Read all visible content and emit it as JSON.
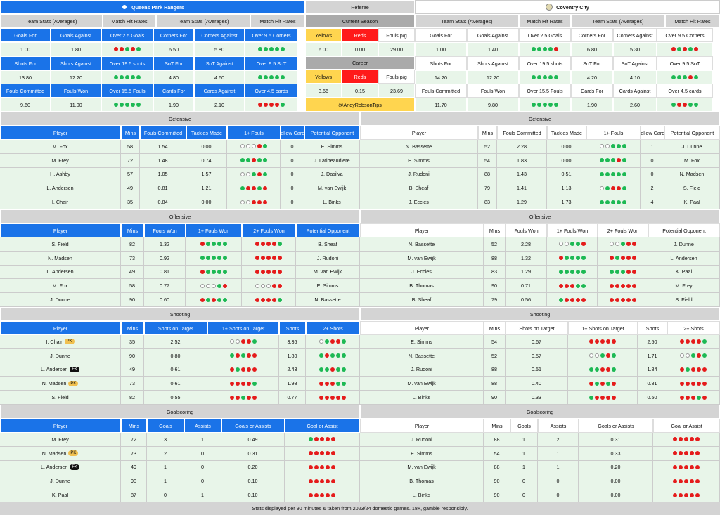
{
  "home": {
    "name": "Queens Park Rangers",
    "color": "#1a73e8"
  },
  "away": {
    "name": "Coventry City"
  },
  "ts": {
    "teamStats": "Team Stats (Averages)",
    "matchHit": "Match Hit Rates",
    "referee": "Referee",
    "currentSeason": "Current Season",
    "career": "Career",
    "handle": "@AndyRobsonTips",
    "r1": [
      "Goals For",
      "Goals Against",
      "Over 2.5 Goals",
      "Corners For",
      "Corners Against",
      "Over 9.5 Corners"
    ],
    "r2": [
      "Shots For",
      "Shots Against",
      "Over 19.5 shots",
      "SoT For",
      "SoT Against",
      "Over 9.5 SoT"
    ],
    "r3": [
      "Fouls Committed",
      "Fouls Won",
      "Over 15.5 Fouls",
      "Cards For",
      "Cards Against",
      "Over 4.5 cards"
    ],
    "refHead": [
      "Yellows",
      "Reds",
      "Fouls p/g"
    ],
    "refCurrent": [
      "6.00",
      "0.00",
      "29.00"
    ],
    "refCareer": [
      "3.66",
      "0.15",
      "23.69"
    ],
    "homeVals": {
      "v1": [
        "1.00",
        "1.80",
        "rrgrg",
        "6.50",
        "5.80",
        "ggggg"
      ],
      "v2": [
        "13.80",
        "12.20",
        "ggggg",
        "4.80",
        "4.60",
        "ggggg"
      ],
      "v3": [
        "9.60",
        "11.00",
        "ggggg",
        "1.90",
        "2.10",
        "rrrrg"
      ]
    },
    "awayVals": {
      "v1": [
        "1.00",
        "1.40",
        "ggggr",
        "6.80",
        "5.30",
        "rgrgr"
      ],
      "v2": [
        "14.20",
        "12.20",
        "ggggg",
        "4.20",
        "4.10",
        "gggrg"
      ],
      "v3": [
        "11.70",
        "9.80",
        "ggggg",
        "1.90",
        "2.60",
        "grrgg"
      ]
    }
  },
  "defensive": {
    "title": "Defensive",
    "headers": [
      "Player",
      "Mins",
      "Fouls Committed",
      "Tackles Made",
      "1+ Fouls",
      "Yellow Cards",
      "Potential Opponent"
    ],
    "home": [
      [
        "M. Fox",
        "58",
        "1.54",
        "0.00",
        "eeerg",
        "0",
        "E. Simms"
      ],
      [
        "M. Frey",
        "72",
        "1.48",
        "0.74",
        "ggrgg",
        "0",
        "J. Latibeaudiere"
      ],
      [
        "H. Ashby",
        "57",
        "1.05",
        "1.57",
        "eegrg",
        "0",
        "J. Dasilva"
      ],
      [
        "L. Andersen",
        "49",
        "0.81",
        "1.21",
        "grrgr",
        "0",
        "M. van Ewijk"
      ],
      [
        "I. Chair",
        "35",
        "0.84",
        "0.00",
        "eerrr",
        "0",
        "L. Binks"
      ]
    ],
    "away": [
      [
        "N. Bassette",
        "52",
        "2.28",
        "0.00",
        "eeggg",
        "1",
        "J. Dunne"
      ],
      [
        "E. Simms",
        "54",
        "1.83",
        "0.00",
        "gggrg",
        "0",
        "M. Fox"
      ],
      [
        "J. Rudoni",
        "88",
        "1.43",
        "0.51",
        "ggggg",
        "0",
        "N. Madsen"
      ],
      [
        "B. Sheaf",
        "79",
        "1.41",
        "1.13",
        "egrrg",
        "2",
        "S. Field"
      ],
      [
        "J. Eccles",
        "83",
        "1.29",
        "1.73",
        "ggggg",
        "4",
        "K. Paal"
      ]
    ]
  },
  "offensive": {
    "title": "Offensive",
    "headers": [
      "Player",
      "Mins",
      "Fouls Won",
      "1+ Fouls Won",
      "2+ Fouls Won",
      "Potential Opponent"
    ],
    "home": [
      [
        "S. Field",
        "82",
        "1.32",
        "rgggg",
        "rrrrg",
        "B. Sheaf"
      ],
      [
        "N. Madsen",
        "73",
        "0.92",
        "ggggg",
        "rrrrr",
        "J. Rudoni"
      ],
      [
        "L. Andersen",
        "49",
        "0.81",
        "rgggg",
        "rrrrr",
        "M. van Ewijk"
      ],
      [
        "M. Fox",
        "58",
        "0.77",
        "eeegr",
        "eeerr",
        "E. Simms"
      ],
      [
        "J. Dunne",
        "90",
        "0.60",
        "rgrgg",
        "rrrrg",
        "N. Bassette"
      ]
    ],
    "away": [
      [
        "N. Bassette",
        "52",
        "2.28",
        "eeggr",
        "eegrr",
        "J. Dunne"
      ],
      [
        "M. van Ewijk",
        "88",
        "1.32",
        "rgggg",
        "rgrrr",
        "L. Andersen"
      ],
      [
        "J. Eccles",
        "83",
        "1.29",
        "ggggg",
        "gggrr",
        "K. Paal"
      ],
      [
        "B. Thomas",
        "90",
        "0.71",
        "rrrgg",
        "rrrrr",
        "M. Frey"
      ],
      [
        "B. Sheaf",
        "79",
        "0.56",
        "grrrr",
        "rrrrr",
        "S. Field"
      ]
    ]
  },
  "shooting": {
    "title": "Shooting",
    "headers": [
      "Player",
      "Mins",
      "Shots on Target",
      "1+ Shots on Target",
      "Shots",
      "2+ Shots"
    ],
    "home": [
      [
        "I. Chair",
        "PK",
        "35",
        "2.52",
        "eerrg",
        "3.36",
        "egrrg"
      ],
      [
        "J. Dunne",
        "",
        "90",
        "0.80",
        "grgrr",
        "1.80",
        "grggg"
      ],
      [
        "L. Andersen",
        "FK",
        "49",
        "0.61",
        "rgrrr",
        "2.43",
        "ggrgg"
      ],
      [
        "N. Madsen",
        "PK",
        "73",
        "0.61",
        "rrrrg",
        "1.98",
        "rrrgg"
      ],
      [
        "S. Field",
        "",
        "82",
        "0.55",
        "rrgrr",
        "0.77",
        "rrrrr"
      ]
    ],
    "away": [
      [
        "E. Simms",
        "",
        "54",
        "0.67",
        "rrrrr",
        "2.50",
        "rrrrg"
      ],
      [
        "N. Bassette",
        "",
        "52",
        "0.57",
        "eegrg",
        "1.71",
        "eegrg"
      ],
      [
        "J. Rudoni",
        "",
        "88",
        "0.51",
        "ggrrg",
        "1.84",
        "rgrrr"
      ],
      [
        "M. van Ewijk",
        "",
        "88",
        "0.40",
        "rgrgr",
        "0.81",
        "rrrrr"
      ],
      [
        "L. Binks",
        "",
        "90",
        "0.33",
        "grrrr",
        "0.50",
        "rrrgr"
      ]
    ]
  },
  "goalscoring": {
    "title": "Goalscoring",
    "headers": [
      "Player",
      "Mins",
      "Goals",
      "Assists",
      "Goals or Assists",
      "Goal or Assist"
    ],
    "home": [
      [
        "M. Frey",
        "",
        "72",
        "3",
        "1",
        "0.49",
        "grrrr"
      ],
      [
        "N. Madsen",
        "PK",
        "73",
        "2",
        "0",
        "0.31",
        "rrrrr"
      ],
      [
        "L. Andersen",
        "FK",
        "49",
        "1",
        "0",
        "0.20",
        "rrrrr"
      ],
      [
        "J. Dunne",
        "",
        "90",
        "1",
        "0",
        "0.10",
        "rrrrr"
      ],
      [
        "K. Paal",
        "",
        "87",
        "0",
        "1",
        "0.10",
        "rrrrr"
      ]
    ],
    "away": [
      [
        "J. Rudoni",
        "",
        "88",
        "1",
        "2",
        "0.31",
        "rrrrr"
      ],
      [
        "E. Simms",
        "",
        "54",
        "1",
        "1",
        "0.33",
        "rrrrr"
      ],
      [
        "M. van Ewijk",
        "",
        "88",
        "1",
        "1",
        "0.20",
        "rrrrr"
      ],
      [
        "B. Thomas",
        "",
        "90",
        "0",
        "0",
        "0.00",
        "rrrrr"
      ],
      [
        "L. Binks",
        "",
        "90",
        "0",
        "0",
        "0.00",
        "rrrrr"
      ]
    ]
  },
  "footer": "Stats displayed per 90 minutes & taken from 2023/24 domestic games. 18+, gamble responsibly."
}
